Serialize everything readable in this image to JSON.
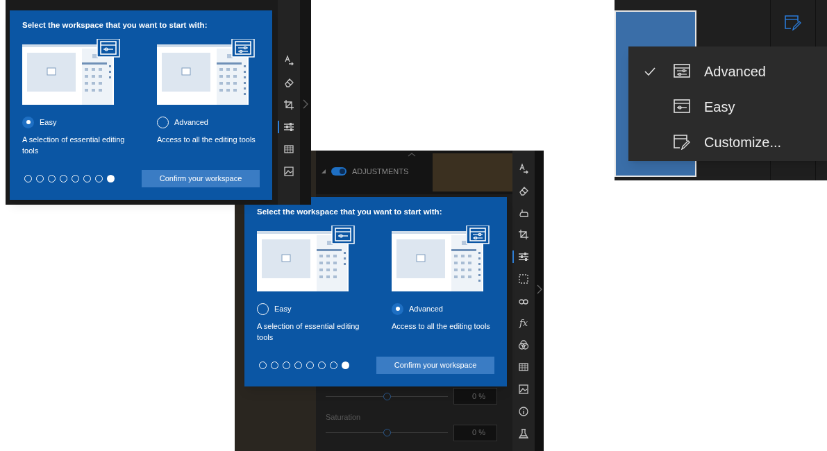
{
  "screens": [
    {
      "dialog": {
        "title": "Select the workspace that you want to start with:",
        "options": [
          {
            "kind": "easy",
            "label": "Easy",
            "description": "A selection of essential editing tools",
            "selected": true
          },
          {
            "kind": "advanced",
            "label": "Advanced",
            "description": "Access to all the editing tools",
            "selected": false
          }
        ],
        "page_dots": [
          {
            "selected": false
          },
          {
            "selected": false
          },
          {
            "selected": false
          },
          {
            "selected": false
          },
          {
            "selected": false
          },
          {
            "selected": false
          },
          {
            "selected": false
          },
          {
            "selected": true
          }
        ],
        "confirm_button": "Confirm your workspace"
      },
      "toolbar": [
        {
          "kind": "text",
          "selected": false
        },
        {
          "kind": "eraser",
          "selected": false
        },
        {
          "kind": "crop",
          "selected": false
        },
        {
          "kind": "sliders",
          "selected": true
        },
        {
          "kind": "grid",
          "selected": false
        },
        {
          "kind": "image",
          "selected": false
        }
      ]
    },
    {
      "dialog": {
        "title": "Select the workspace that you want to start with:",
        "options": [
          {
            "kind": "easy",
            "label": "Easy",
            "description": "A selection of essential editing tools",
            "selected": false
          },
          {
            "kind": "advanced",
            "label": "Advanced",
            "description": "Access to all the editing tools",
            "selected": true
          }
        ],
        "page_dots": [
          {
            "selected": false
          },
          {
            "selected": false
          },
          {
            "selected": false
          },
          {
            "selected": false
          },
          {
            "selected": false
          },
          {
            "selected": false
          },
          {
            "selected": false
          },
          {
            "selected": true
          }
        ],
        "confirm_button": "Confirm your workspace"
      },
      "section": {
        "label": "ADJUSTMENTS",
        "on": true
      },
      "sliders": [
        {
          "value": "0 %",
          "level": 0.5
        },
        {
          "label": "Saturation",
          "value": "0 %",
          "level": 0.5
        }
      ],
      "toolbar": [
        {
          "kind": "text",
          "selected": false
        },
        {
          "kind": "eraser",
          "selected": false
        },
        {
          "kind": "hand",
          "selected": false
        },
        {
          "kind": "crop",
          "selected": false
        },
        {
          "kind": "sliders",
          "selected": true
        },
        {
          "kind": "selection",
          "selected": false
        },
        {
          "kind": "glasses",
          "selected": false
        },
        {
          "kind": "fx",
          "glyph": "fx",
          "selected": false
        },
        {
          "kind": "circles",
          "selected": false
        },
        {
          "kind": "grid",
          "selected": false
        },
        {
          "kind": "image",
          "selected": false
        },
        {
          "kind": "info",
          "selected": false
        },
        {
          "kind": "flask",
          "selected": false
        }
      ]
    }
  ],
  "menu": {
    "items": [
      {
        "kind": "advanced",
        "label": "Advanced",
        "checked": true
      },
      {
        "kind": "easy",
        "label": "Easy",
        "checked": false
      },
      {
        "kind": "customize",
        "label": "Customize...",
        "checked": false
      }
    ]
  }
}
